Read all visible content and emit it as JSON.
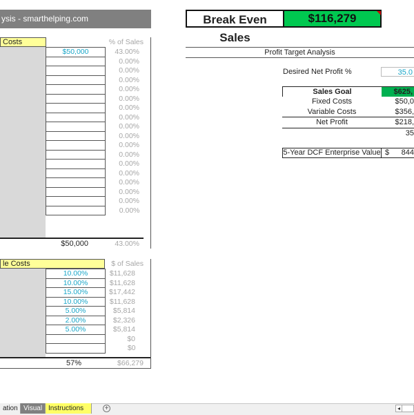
{
  "title_bar": "ysis - smarthelping.com",
  "break_even": {
    "label": "Break Even Sales",
    "value": "$116,279",
    "color": "#00c850"
  },
  "fixed_costs": {
    "header": "Costs",
    "pct_header": "% of Sales",
    "rows": [
      {
        "value": "$50,000",
        "pct": "43.00%"
      },
      {
        "value": "",
        "pct": "0.00%"
      },
      {
        "value": "",
        "pct": "0.00%"
      },
      {
        "value": "",
        "pct": "0.00%"
      },
      {
        "value": "",
        "pct": "0.00%"
      },
      {
        "value": "",
        "pct": "0.00%"
      },
      {
        "value": "",
        "pct": "0.00%"
      },
      {
        "value": "",
        "pct": "0.00%"
      },
      {
        "value": "",
        "pct": "0.00%"
      },
      {
        "value": "",
        "pct": "0.00%"
      },
      {
        "value": "",
        "pct": "0.00%"
      },
      {
        "value": "",
        "pct": "0.00%"
      },
      {
        "value": "",
        "pct": "0.00%"
      },
      {
        "value": "",
        "pct": "0.00%"
      },
      {
        "value": "",
        "pct": "0.00%"
      },
      {
        "value": "",
        "pct": "0.00%"
      },
      {
        "value": "",
        "pct": "0.00%"
      },
      {
        "value": "",
        "pct": "0.00%"
      }
    ],
    "total": "$50,000",
    "total_pct": "43.00%"
  },
  "variable_costs": {
    "header": "le Costs",
    "amt_header": "$ of Sales",
    "rows": [
      {
        "pct": "10.00%",
        "amt": "$11,628"
      },
      {
        "pct": "10.00%",
        "amt": "$11,628"
      },
      {
        "pct": "15.00%",
        "amt": "$17,442"
      },
      {
        "pct": "10.00%",
        "amt": "$11,628"
      },
      {
        "pct": "5.00%",
        "amt": "$5,814"
      },
      {
        "pct": "2.00%",
        "amt": "$2,326"
      },
      {
        "pct": "5.00%",
        "amt": "$5,814"
      },
      {
        "pct": "",
        "amt": "$0"
      },
      {
        "pct": "",
        "amt": "$0"
      }
    ],
    "total_pct": "57%",
    "total_amt": "$66,279"
  },
  "profit_target": {
    "title": "Profit Target Analysis",
    "desired_label": "Desired Net Profit %",
    "desired_value": "35.0",
    "sales_goal_label": "Sales Goal",
    "sales_goal_value": "$625,",
    "fixed_label": "Fixed Costs",
    "fixed_value": "$50,0",
    "variable_label": "Variable Costs",
    "variable_value": "$356,",
    "net_label": "Net Profit",
    "net_value": "$218,",
    "net_pct": "35",
    "dcf_label": "5-Year DCF Enterprise Value",
    "dcf_currency": "$",
    "dcf_value": "844"
  },
  "tabs": [
    "ation",
    "Visual",
    "Instructions"
  ],
  "add_sheet_icon": "plus-circle-icon",
  "scroll_left_icon": "arrow-left-icon"
}
